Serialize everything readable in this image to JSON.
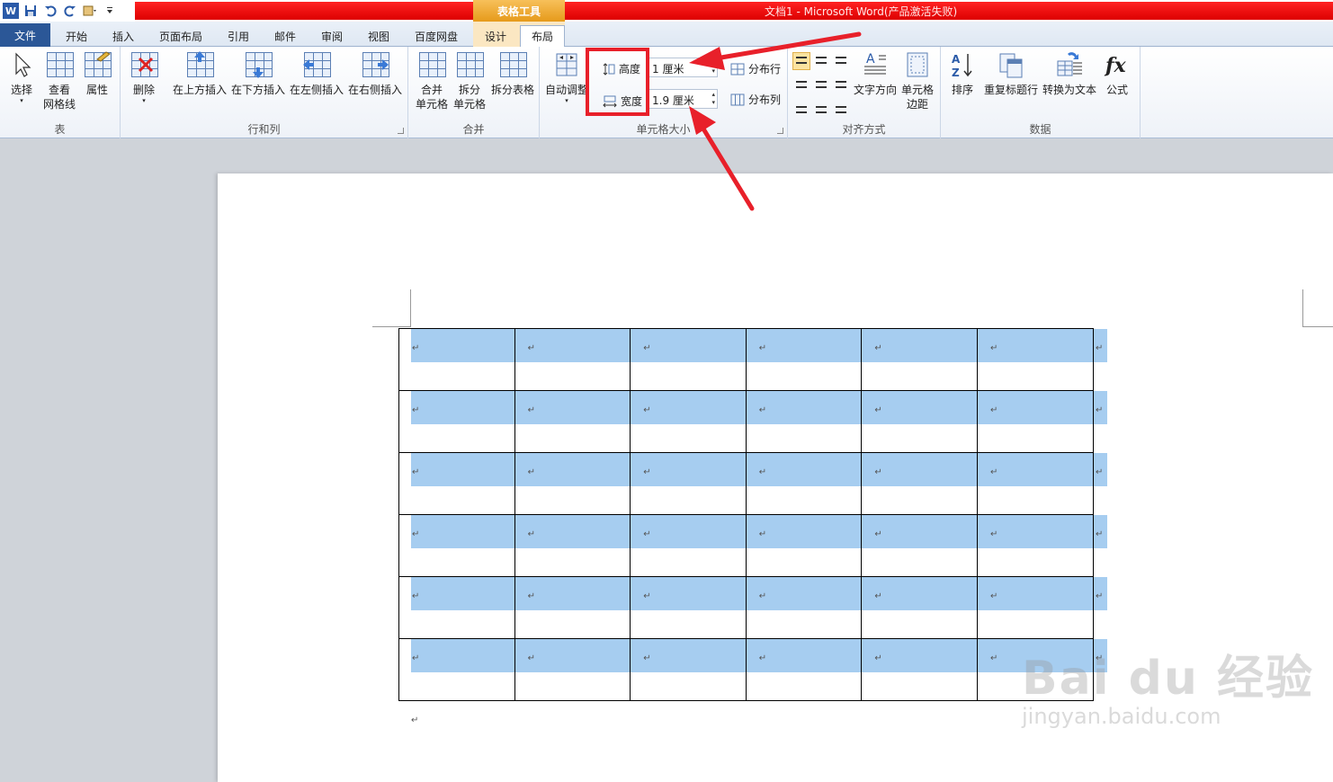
{
  "window": {
    "title": "文档1 - Microsoft Word(产品激活失败)",
    "context_tab_group": "表格工具"
  },
  "tabs": [
    {
      "label": "文件"
    },
    {
      "label": "开始"
    },
    {
      "label": "插入"
    },
    {
      "label": "页面布局"
    },
    {
      "label": "引用"
    },
    {
      "label": "邮件"
    },
    {
      "label": "审阅"
    },
    {
      "label": "视图"
    },
    {
      "label": "百度网盘"
    },
    {
      "label": "设计"
    },
    {
      "label": "布局"
    }
  ],
  "ribbon": {
    "groups": {
      "table": {
        "label": "表",
        "select": "选择",
        "view_gridlines_1": "查看",
        "view_gridlines_2": "网格线",
        "properties": "属性"
      },
      "rows_cols": {
        "label": "行和列",
        "delete": "删除",
        "insert_above": "在上方插入",
        "insert_below": "在下方插入",
        "insert_left": "在左侧插入",
        "insert_right": "在右侧插入"
      },
      "merge": {
        "label": "合并",
        "merge_1": "合并",
        "merge_2": "单元格",
        "split_1": "拆分",
        "split_2": "单元格",
        "split_table": "拆分表格"
      },
      "cell_size": {
        "label": "单元格大小",
        "autofit": "自动调整",
        "height_label": "高度",
        "height_value": "1 厘米",
        "width_label": "宽度",
        "width_value": "1.9 厘米",
        "distribute_rows": "分布行",
        "distribute_cols": "分布列"
      },
      "alignment": {
        "label": "对齐方式",
        "text_direction": "文字方向",
        "cell_margins_1": "单元格",
        "cell_margins_2": "边距"
      },
      "data": {
        "label": "数据",
        "sort": "排序",
        "repeat_header": "重复标题行",
        "convert_text": "转换为文本",
        "formula": "公式"
      }
    }
  },
  "document": {
    "table": {
      "rows": 6,
      "cols": 6,
      "cell_mark": "↵"
    },
    "paragraph_mark": "↵"
  },
  "watermark": {
    "brand": "Bai du 经验",
    "url": "jingyan.baidu.com"
  },
  "colors": {
    "accent": "#2b5797",
    "selection": "#a6cdf0",
    "annotation": "#e8202a",
    "title_bar": "#e00000"
  }
}
